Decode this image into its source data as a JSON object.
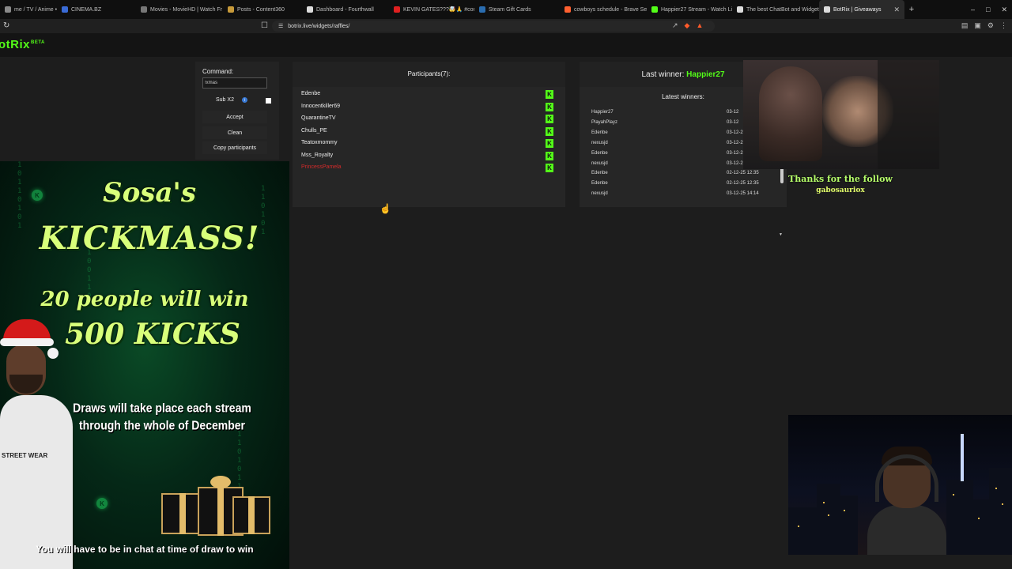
{
  "browser": {
    "tabs": [
      {
        "title": "me / TV / Anime • freeme",
        "color": "#8a8a8a"
      },
      {
        "title": "CINEMA.BZ",
        "color": "#3a6bd6"
      },
      {
        "title": "Movies - MovieHD | Watch Fr",
        "color": "#777"
      },
      {
        "title": "Posts - Content360",
        "color": "#c79a3a"
      },
      {
        "title": "Dashboard - Fourthwall",
        "color": "#ddd"
      },
      {
        "title": "KEVIN GATES???🤯🙏 #come",
        "color": "#e02020"
      },
      {
        "title": "Steam Gift Cards",
        "color": "#2a6db0"
      },
      {
        "title": "cowboys schedule - Brave Sea",
        "color": "#ff6030"
      },
      {
        "title": "Happier27 Stream - Watch Live",
        "color": "#53fc18"
      },
      {
        "title": "The best ChatBot and Widgets",
        "color": "#ddd"
      },
      {
        "title": "BotRix | Giveaways",
        "color": "#ddd"
      }
    ],
    "active_tab_index": 10,
    "url": "botrix.live/widgets/raffles/",
    "icons": {
      "reload": "reload-icon",
      "bookmark": "bookmark-icon",
      "new_tab": "+",
      "minimize": "–",
      "maximize": "□",
      "close": "✕"
    }
  },
  "app": {
    "logo": "otRix",
    "logo_badge": "BETA"
  },
  "controls": {
    "command_label": "Command:",
    "command_value": "!xmas",
    "sub_label": "Sub X2",
    "sub_info_icon": "i",
    "accept_label": "Accept",
    "clean_label": "Clean",
    "copy_label": "Copy participants"
  },
  "participants": {
    "title": "Participants(7):",
    "badge": "K",
    "items": [
      {
        "name": "Edenbe",
        "red": false
      },
      {
        "name": "Innocentkiller69",
        "red": false
      },
      {
        "name": "QuarantineTV",
        "red": false
      },
      {
        "name": "Chulls_PE",
        "red": false
      },
      {
        "name": "Teatoxmommy",
        "red": false
      },
      {
        "name": "Mss_Royalty",
        "red": false
      },
      {
        "name": "PrincessPamela",
        "red": true
      }
    ]
  },
  "winners": {
    "last_label": "Last winner:",
    "last_name": "Happier27",
    "latest_title": "Latest winners:",
    "items": [
      {
        "name": "Happier27",
        "date": "03-12"
      },
      {
        "name": "PlayahPlayz",
        "date": "03-12"
      },
      {
        "name": "Edenbe",
        "date": "03-12-25 14:19"
      },
      {
        "name": "nexusjd",
        "date": "03-12-25 14:14"
      },
      {
        "name": "Edenbe",
        "date": "03-12-25 14:19"
      },
      {
        "name": "nexusjd",
        "date": "03-12-25 14:14"
      },
      {
        "name": "Edenbe",
        "date": "02-12-25 12:35"
      },
      {
        "name": "Edenbe",
        "date": "02-12-25 12:35"
      },
      {
        "name": "nexusjd",
        "date": "03-12-25 14:14"
      }
    ]
  },
  "follow_alert": {
    "line1": "Thanks for the follow",
    "line2": "gabosauriox"
  },
  "kickmass": {
    "title1": "Sosa's",
    "title2": "KICKMASS!",
    "line3": "20 people will win",
    "line4": "500 KICKS",
    "desc1": "Draws will take place each stream",
    "desc2": "through the whole of December",
    "footer": "You will have to be in chat at time of draw to win",
    "shirt_text": "STREET WEAR",
    "k_glyph": "K"
  }
}
